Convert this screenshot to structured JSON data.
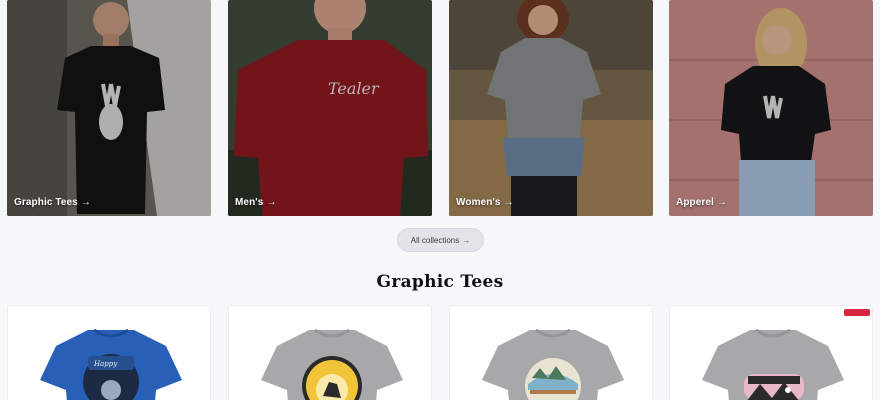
{
  "collections": [
    {
      "label": "Graphic Tees",
      "arrow": "→"
    },
    {
      "label": "Men's",
      "arrow": "→"
    },
    {
      "label": "Women's",
      "arrow": "→"
    },
    {
      "label": "Apperel",
      "arrow": "→"
    }
  ],
  "all_collections": {
    "label": "All collections",
    "arrow": "→"
  },
  "section": {
    "title": "Graphic Tees"
  },
  "products": [
    {
      "shirt_color": "#2860b8",
      "graphic": "blue-circle-badge"
    },
    {
      "shirt_color": "#a8a8aa",
      "graphic": "yellow-circle-badge"
    },
    {
      "shirt_color": "#a8a8aa",
      "graphic": "lake-life-badge"
    },
    {
      "shirt_color": "#a8a8aa",
      "graphic": "mountain-badge",
      "badge_color": "#d7263d"
    }
  ]
}
